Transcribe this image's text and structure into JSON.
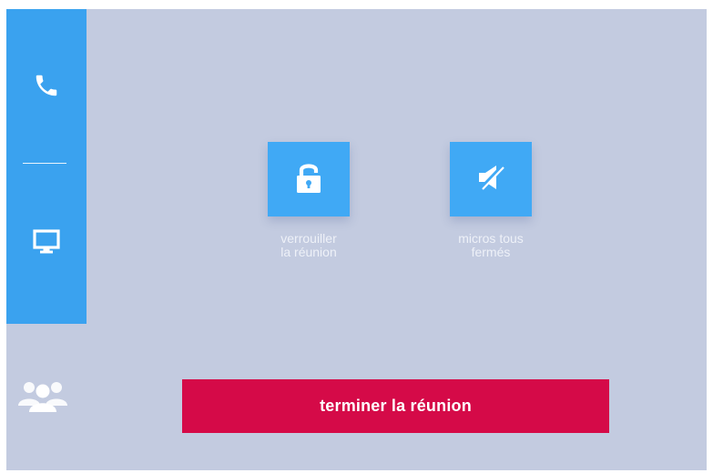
{
  "sidebar": {
    "items": [
      {
        "icon": "phone-icon",
        "label": ""
      },
      {
        "icon": "monitor-icon",
        "label": ""
      }
    ],
    "participants_icon": "participants-icon"
  },
  "actions": {
    "lock": {
      "icon": "padlock-icon",
      "label": "verrouiller\nla réunion"
    },
    "mute": {
      "icon": "speaker-muted-icon",
      "label": "micros tous\nfermés"
    }
  },
  "end_meeting": {
    "label": "terminer la réunion"
  },
  "colors": {
    "background": "#c3cbe0",
    "sidebar": "#3aa2ef",
    "tile": "#40a9f5",
    "danger": "#d50a48",
    "label": "#eef1f8"
  }
}
